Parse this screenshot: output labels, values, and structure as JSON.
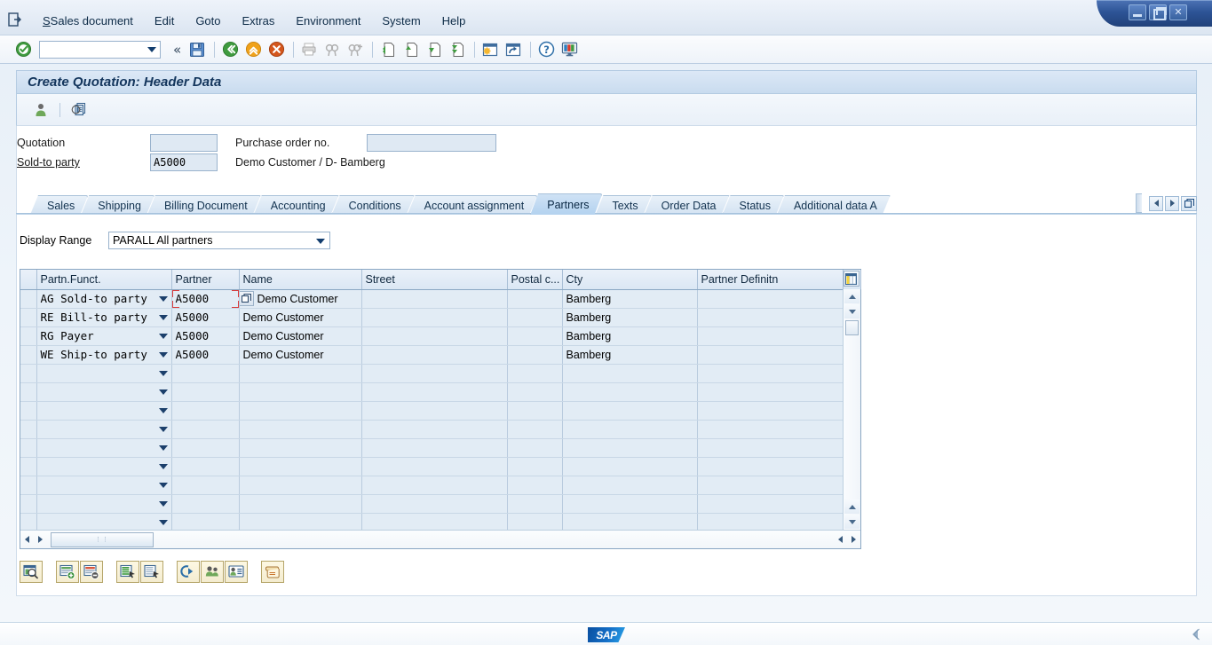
{
  "window": {
    "minimize_label": "Minimize",
    "maximize_label": "Restore",
    "close_label": "Close"
  },
  "menubar": {
    "system_icon": "session-icon",
    "items": [
      {
        "label": "Sales document",
        "accel": "S"
      },
      {
        "label": "Edit",
        "accel": "E"
      },
      {
        "label": "Goto",
        "accel": "G"
      },
      {
        "label": "Extras",
        "accel": "a"
      },
      {
        "label": "Environment",
        "accel": "n"
      },
      {
        "label": "System",
        "accel": "y"
      },
      {
        "label": "Help",
        "accel": "H"
      }
    ]
  },
  "toolbar": {
    "enter_label": "Enter",
    "command_field_value": "",
    "command_field_placeholder": "",
    "collapse_label": "«",
    "buttons": [
      {
        "name": "save-button",
        "label": "Save"
      },
      {
        "name": "back-button",
        "label": "Back"
      },
      {
        "name": "exit-button",
        "label": "Exit"
      },
      {
        "name": "cancel-button",
        "label": "Cancel"
      },
      {
        "name": "print-button",
        "label": "Print"
      },
      {
        "name": "find-button",
        "label": "Find"
      },
      {
        "name": "find-next-button",
        "label": "Find Next"
      },
      {
        "name": "first-page-button",
        "label": "First Page"
      },
      {
        "name": "previous-page-button",
        "label": "Previous Page"
      },
      {
        "name": "next-page-button",
        "label": "Next Page"
      },
      {
        "name": "last-page-button",
        "label": "Last Page"
      },
      {
        "name": "create-session-button",
        "label": "Create New Session"
      },
      {
        "name": "create-shortcut-button",
        "label": "Create Shortcut"
      },
      {
        "name": "help-button",
        "label": "Help"
      },
      {
        "name": "customize-layout-button",
        "label": "Customize Local Layout"
      }
    ]
  },
  "screen": {
    "title": "Create Quotation: Header Data",
    "header_buttons": [
      {
        "name": "display-partner-button",
        "label": "Partner"
      },
      {
        "name": "document-overview-button",
        "label": "Document Overview"
      }
    ]
  },
  "form": {
    "quotation_label": "Quotation",
    "quotation_value": "",
    "purchase_order_label": "Purchase order no.",
    "purchase_order_value": "",
    "sold_to_party_label": "Sold-to party",
    "sold_to_party_value": "A5000",
    "sold_to_party_description": "Demo Customer / D- Bamberg"
  },
  "tabs": {
    "items": [
      {
        "label": "Sales",
        "active": false
      },
      {
        "label": "Shipping",
        "active": false
      },
      {
        "label": "Billing Document",
        "active": false
      },
      {
        "label": "Accounting",
        "active": false
      },
      {
        "label": "Conditions",
        "active": false
      },
      {
        "label": "Account assignment",
        "active": false
      },
      {
        "label": "Partners",
        "active": true
      },
      {
        "label": "Texts",
        "active": false
      },
      {
        "label": "Order Data",
        "active": false
      },
      {
        "label": "Status",
        "active": false
      },
      {
        "label": "Additional data A",
        "active": false
      }
    ],
    "nav_prev_label": "◄",
    "nav_next_label": "►",
    "nav_list_label": "Tab List"
  },
  "display_range": {
    "label": "Display Range",
    "value": "PARALL All partners"
  },
  "table": {
    "columns": [
      {
        "key": "partn_funct",
        "label": "Partn.Funct.",
        "width": 152
      },
      {
        "key": "partner",
        "label": "Partner",
        "width": 76
      },
      {
        "key": "name",
        "label": "Name",
        "width": 138
      },
      {
        "key": "street",
        "label": "Street",
        "width": 164
      },
      {
        "key": "postal_code",
        "label": "Postal c...",
        "width": 62
      },
      {
        "key": "city",
        "label": "Cty",
        "width": 152
      },
      {
        "key": "partner_definition",
        "label": "Partner Definitn",
        "width": 168
      }
    ],
    "config_button_label": "Table Settings",
    "rows": [
      {
        "partn_funct": "AG Sold-to party",
        "partner": "A5000",
        "name": "Demo Customer",
        "street": "",
        "postal_code": "",
        "city": "Bamberg",
        "partner_definition": "",
        "focused": true
      },
      {
        "partn_funct": "RE Bill-to party",
        "partner": "A5000",
        "name": "Demo Customer",
        "street": "",
        "postal_code": "",
        "city": "Bamberg",
        "partner_definition": "",
        "focused": false
      },
      {
        "partn_funct": "RG Payer",
        "partner": "A5000",
        "name": "Demo Customer",
        "street": "",
        "postal_code": "",
        "city": "Bamberg",
        "partner_definition": "",
        "focused": false
      },
      {
        "partn_funct": "WE Ship-to party",
        "partner": "A5000",
        "name": "Demo Customer",
        "street": "",
        "postal_code": "",
        "city": "Bamberg",
        "partner_definition": "",
        "focused": false
      },
      {
        "partn_funct": "",
        "partner": "",
        "name": "",
        "street": "",
        "postal_code": "",
        "city": "",
        "partner_definition": "",
        "focused": false
      },
      {
        "partn_funct": "",
        "partner": "",
        "name": "",
        "street": "",
        "postal_code": "",
        "city": "",
        "partner_definition": "",
        "focused": false
      },
      {
        "partn_funct": "",
        "partner": "",
        "name": "",
        "street": "",
        "postal_code": "",
        "city": "",
        "partner_definition": "",
        "focused": false
      },
      {
        "partn_funct": "",
        "partner": "",
        "name": "",
        "street": "",
        "postal_code": "",
        "city": "",
        "partner_definition": "",
        "focused": false
      },
      {
        "partn_funct": "",
        "partner": "",
        "name": "",
        "street": "",
        "postal_code": "",
        "city": "",
        "partner_definition": "",
        "focused": false
      },
      {
        "partn_funct": "",
        "partner": "",
        "name": "",
        "street": "",
        "postal_code": "",
        "city": "",
        "partner_definition": "",
        "focused": false
      },
      {
        "partn_funct": "",
        "partner": "",
        "name": "",
        "street": "",
        "postal_code": "",
        "city": "",
        "partner_definition": "",
        "focused": false
      },
      {
        "partn_funct": "",
        "partner": "",
        "name": "",
        "street": "",
        "postal_code": "",
        "city": "",
        "partner_definition": "",
        "focused": false
      },
      {
        "partn_funct": "",
        "partner": "",
        "name": "",
        "street": "",
        "postal_code": "",
        "city": "",
        "partner_definition": "",
        "focused": false
      }
    ],
    "scroll": {
      "h_left_label": "◄",
      "h_right_label": "►",
      "v_up_label": "▲",
      "v_down_label": "▼",
      "thumb_grip": "⋮⋮"
    }
  },
  "bottom_buttons": [
    {
      "name": "detail-button",
      "label": "Partner Detail"
    },
    {
      "name": "insert-row-button",
      "label": "Insert Row"
    },
    {
      "name": "delete-row-button",
      "label": "Delete Row"
    },
    {
      "name": "select-all-button",
      "label": "Select All"
    },
    {
      "name": "deselect-all-button",
      "label": "Deselect All"
    },
    {
      "name": "change-partner-button",
      "label": "Change Partner"
    },
    {
      "name": "customer-master-button",
      "label": "Customer Master"
    },
    {
      "name": "contact-person-button",
      "label": "Contact Person"
    },
    {
      "name": "partner-history-button",
      "label": "Partner History"
    }
  ],
  "statusbar": {
    "logo": "SAP",
    "message": ""
  }
}
